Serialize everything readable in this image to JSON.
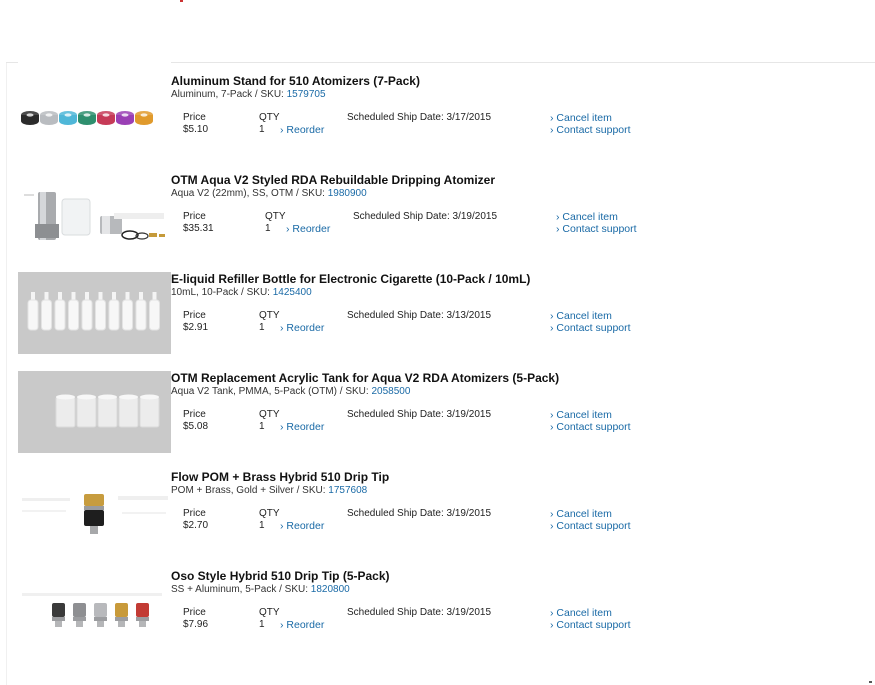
{
  "labels": {
    "price": "Price",
    "qty": "QTY",
    "reorder": "› Reorder",
    "ship_prefix": "Scheduled Ship Date:",
    "cancel": "› Cancel item",
    "support": "› Contact support",
    "sku_prefix": "SKU:"
  },
  "items": [
    {
      "title": "Aluminum Stand for 510 Atomizers (7-Pack)",
      "options": "Aluminum, 7-Pack",
      "sku": "1579705",
      "price": "$5.10",
      "qty": "1",
      "ship_date": "3/17/2015",
      "thumb_colors": [
        "#2b2b2b",
        "#b9bcc0",
        "#4fb7d8",
        "#2e8f6e",
        "#c63a57",
        "#9a3fb5",
        "#e09a2c"
      ]
    },
    {
      "title": "OTM Aqua V2 Styled RDA Rebuildable Dripping Atomizer",
      "options": "Aqua V2 (22mm), SS, OTM",
      "sku": "1980900",
      "price": "$35.31",
      "qty": "1",
      "ship_date": "3/19/2015"
    },
    {
      "title": "E-liquid Refiller Bottle for Electronic Cigarette (10-Pack / 10mL)",
      "options": "10mL, 10-Pack",
      "sku": "1425400",
      "price": "$2.91",
      "qty": "1",
      "ship_date": "3/13/2015"
    },
    {
      "title": "OTM Replacement Acrylic Tank for Aqua V2 RDA Atomizers (5-Pack)",
      "options": "Aqua V2 Tank, PMMA, 5-Pack (OTM)",
      "sku": "2058500",
      "price": "$5.08",
      "qty": "1",
      "ship_date": "3/19/2015"
    },
    {
      "title": "Flow POM + Brass Hybrid 510 Drip Tip",
      "options": "POM + Brass, Gold + Silver",
      "sku": "1757608",
      "price": "$2.70",
      "qty": "1",
      "ship_date": "3/19/2015"
    },
    {
      "title": "Oso Style Hybrid 510 Drip Tip (5-Pack)",
      "options": "SS + Aluminum, 5-Pack",
      "sku": "1820800",
      "price": "$7.96",
      "qty": "1",
      "ship_date": "3/19/2015",
      "thumb_colors": [
        "#3a3a3a",
        "#8e8f92",
        "#b8b9bc",
        "#c89a3a",
        "#c23b34"
      ]
    }
  ]
}
